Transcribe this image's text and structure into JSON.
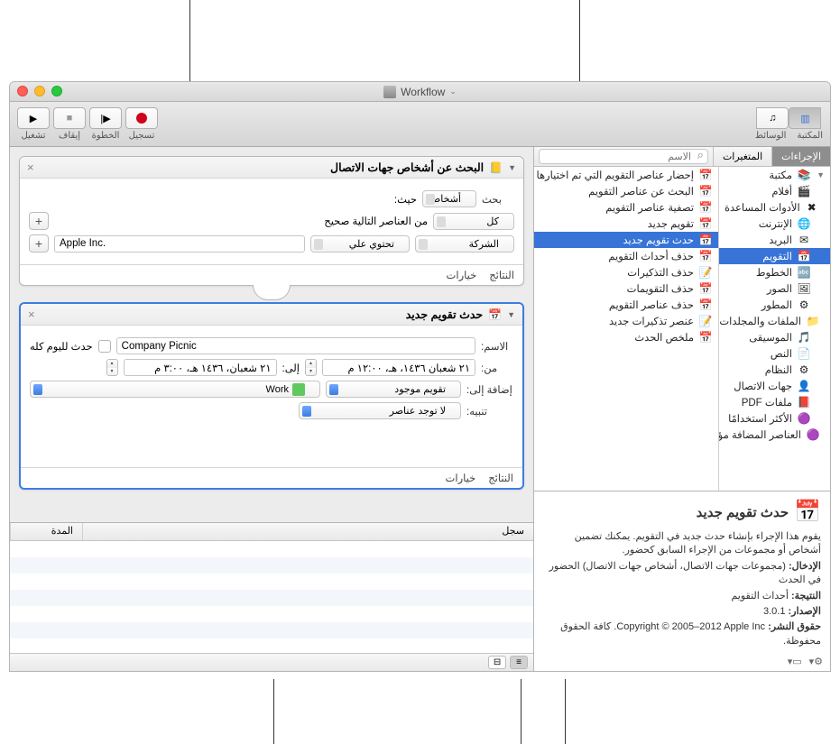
{
  "window": {
    "title": "Workflow",
    "dropdown_indicator": "⌄"
  },
  "toolbar": {
    "library_label": "المكتبة",
    "media_label": "الوسائط",
    "record_label": "تسجيل",
    "step_label": "الخطوة",
    "stop_label": "إيقاف",
    "run_label": "تشغيل"
  },
  "sidebar": {
    "tabs": {
      "actions": "الإجراءات",
      "variables": "المتغيرات"
    },
    "search_placeholder": "الاسم",
    "categories": [
      {
        "icon": "📚",
        "label": "مكتبة",
        "disclosure": true
      },
      {
        "icon": "🎬",
        "label": "أفلام"
      },
      {
        "icon": "✖",
        "label": "الأدوات المساعدة"
      },
      {
        "icon": "🌐",
        "label": "الإنترنت"
      },
      {
        "icon": "✉",
        "label": "البريد"
      },
      {
        "icon": "📅",
        "label": "التقويم",
        "selected": true
      },
      {
        "icon": "🔤",
        "label": "الخطوط"
      },
      {
        "icon": "🖼",
        "label": "الصور"
      },
      {
        "icon": "⚙",
        "label": "المطور"
      },
      {
        "icon": "📁",
        "label": "الملفات والمجلدات"
      },
      {
        "icon": "🎵",
        "label": "الموسيقى"
      },
      {
        "icon": "📄",
        "label": "النص"
      },
      {
        "icon": "⚙",
        "label": "النظام"
      },
      {
        "icon": "👤",
        "label": "جهات الاتصال"
      },
      {
        "icon": "📕",
        "label": "ملفات PDF"
      },
      {
        "icon": "🟣",
        "label": "الأكثر استخدامًا"
      },
      {
        "icon": "🟣",
        "label": "العناصر المضافة مؤخرًا"
      }
    ],
    "actions": [
      {
        "icon": "📅",
        "label": "إحضار عناصر التقويم التي تم اختيارها"
      },
      {
        "icon": "📅",
        "label": "البحث عن عناصر التقويم"
      },
      {
        "icon": "📅",
        "label": "تصفية عناصر التقويم"
      },
      {
        "icon": "📅",
        "label": "تقويم جديد"
      },
      {
        "icon": "📅",
        "label": "حدث تقويم جديد",
        "selected": true
      },
      {
        "icon": "📅",
        "label": "حذف أحداث التقويم"
      },
      {
        "icon": "📝",
        "label": "حذف التذكيرات"
      },
      {
        "icon": "📅",
        "label": "حذف التقويمات"
      },
      {
        "icon": "📅",
        "label": "حذف عناصر التقويم"
      },
      {
        "icon": "📝",
        "label": "عنصر تذكيرات جديد"
      },
      {
        "icon": "📅",
        "label": "ملخص الحدث"
      }
    ]
  },
  "info": {
    "title": "حدث تقويم جديد",
    "description": "يقوم هذا الإجراء بإنشاء حدث جديد في التقويم. يمكنك تضمين أشخاص أو مجموعات من الإجراء السابق كحضور.",
    "input_label": "الإدخال:",
    "input_value": "(مجموعات جهات الاتصال، أشخاص جهات الاتصال) الحضور في الحدث",
    "result_label": "النتيجة:",
    "result_value": "أحداث التقويم",
    "version_label": "الإصدار:",
    "version_value": "3.0.1",
    "copyright_label": "حقوق النشر:",
    "copyright_value": "Copyright © 2005–2012 Apple Inc. كافة الحقوق محفوظة."
  },
  "workflow": {
    "action1": {
      "title": "البحث عن أشخاص جهات الاتصال",
      "search_label": "بحث",
      "search_type": "أشخاص",
      "where_label": "حيث:",
      "all_label": "كل",
      "conditions_text": "من العناصر التالية صحيح",
      "field": "الشركة",
      "operator": "تحتوي علي",
      "value": "Apple Inc.",
      "results": "النتائج",
      "options": "خيارات"
    },
    "action2": {
      "title": "حدث تقويم جديد",
      "name_label": "الاسم:",
      "name_value": "Company Picnic",
      "allday_label": "حدث لليوم كله",
      "from_label": "من:",
      "from_value": "٢١ شعبان ١٤٣٦، هـ، ١٢:٠٠ م",
      "to_label": "إلى:",
      "to_value": "٢١ شعبان، ١٤٣٦ هـ، ٣:٠٠ م",
      "addto_label": "إضافة إلى:",
      "addto_value": "تقويم موجود",
      "calendar_name": "Work",
      "alarm_label": "تنبيه:",
      "alarm_value": "لا توجد عناصر",
      "results": "النتائج",
      "options": "خيارات"
    }
  },
  "log": {
    "col_log": "سجل",
    "col_duration": "المدة"
  }
}
